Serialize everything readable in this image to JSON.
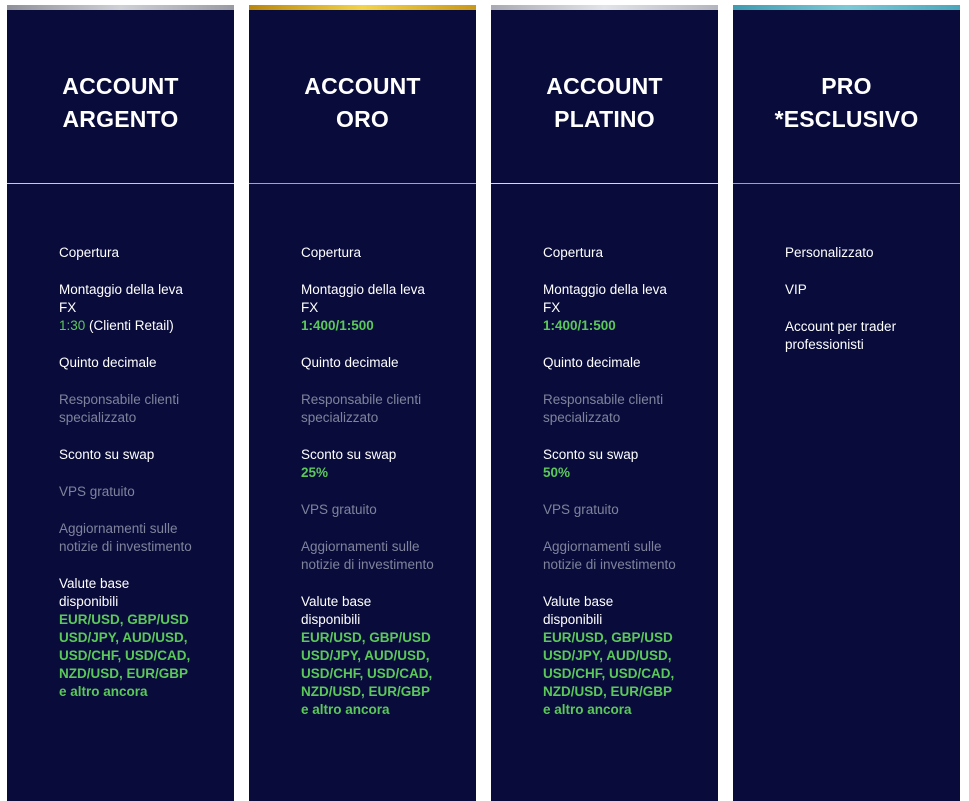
{
  "colors": {
    "card_bg": "#090c3b",
    "text": "#ffffff",
    "text_dim": "#80839b",
    "highlight": "#5bc85a"
  },
  "cards": [
    {
      "title": "ACCOUNT\nARGENTO",
      "accent": "silver",
      "topbar_color": "linear-gradient(90deg,#8f8f99,#cfd0d6 50%,#9a9aa4)",
      "divider_color": "#c9cad3",
      "features": {
        "copertura": "Copertura",
        "leva_label": "Montaggio della leva FX",
        "leva_value": "1:30",
        "leva_suffix": " (Clienti Retail)",
        "quinto": "Quinto decimale",
        "responsabile": "Responsabile clienti specializzato",
        "sconto_label": "Sconto su swap",
        "vps": "VPS gratuito",
        "aggiornamenti": "Aggiornamenti sulle notizie di investimento",
        "valute_label": "Valute base disponibili",
        "valute_value": "EUR/USD, GBP/USD USD/JPY, AUD/USD, USD/CHF, USD/CAD, NZD/USD, EUR/GBP e altro ancora"
      }
    },
    {
      "title": "ACCOUNT\nORO",
      "accent": "gold",
      "topbar_color": "linear-gradient(90deg,#b8860b,#f3d34a 50%,#c9981a)",
      "divider_color": "#d4a62a",
      "features": {
        "copertura": "Copertura",
        "leva_label": "Montaggio della leva FX",
        "leva_value": "1:400/1:500",
        "quinto": "Quinto decimale",
        "responsabile": "Responsabile clienti specializzato",
        "sconto_label": "Sconto su swap",
        "sconto_value": "25%",
        "vps": "VPS gratuito",
        "aggiornamenti": "Aggiornamenti sulle notizie di investimento",
        "valute_label": "Valute base disponibili",
        "valute_value": "EUR/USD, GBP/USD USD/JPY, AUD/USD, USD/CHF, USD/CAD, NZD/USD, EUR/GBP e altro ancora"
      }
    },
    {
      "title": "ACCOUNT\nPLATINO",
      "accent": "platinum",
      "topbar_color": "linear-gradient(90deg,#a9a9b3,#e2e3e8 50%,#b3b4bd)",
      "divider_color": "#d8d9e0",
      "features": {
        "copertura": "Copertura",
        "leva_label": "Montaggio della leva FX",
        "leva_value": "1:400/1:500",
        "quinto": "Quinto decimale",
        "responsabile": "Responsabile clienti specializzato",
        "sconto_label": "Sconto su swap",
        "sconto_value": "50%",
        "vps": "VPS gratuito",
        "aggiornamenti": "Aggiornamenti sulle notizie di investimento",
        "valute_label": "Valute base disponibili",
        "valute_value": "EUR/USD, GBP/USD USD/JPY, AUD/USD, USD/CHF, USD/CAD, NZD/USD, EUR/GBP e altro ancora"
      }
    },
    {
      "title": "PRO\n*ESCLUSIVO",
      "accent": "teal",
      "topbar_color": "linear-gradient(90deg,#3e9bb0,#7cc9d6 50%,#4aa7bb)",
      "divider_color": "#6fb6c6",
      "features": {
        "personalizzato": "Personalizzato",
        "vip": "VIP",
        "professionisti": "Account per trader professionisti"
      }
    }
  ]
}
